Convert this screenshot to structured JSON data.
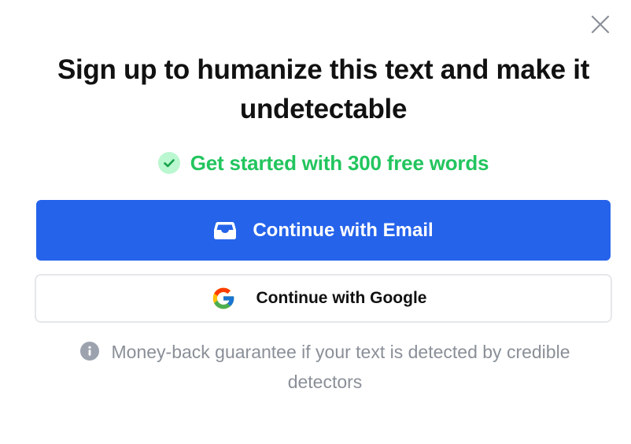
{
  "dialog": {
    "title": "Sign up to humanize this text and make it undetectable",
    "promo_text": "Get started with 300 free words",
    "email_button_label": "Continue with Email",
    "google_button_label": "Continue with Google",
    "note_text": "Money-back guarantee if your text is detected by credible detectors",
    "icons": {
      "close": "close-icon",
      "check": "check-circle-icon",
      "email": "inbox-icon",
      "google": "google-logo-icon",
      "info": "info-icon"
    }
  },
  "colors": {
    "primary": "#2563eb",
    "success": "#22c55e",
    "muted_text": "#8a8f98",
    "border": "#e5e7eb"
  }
}
